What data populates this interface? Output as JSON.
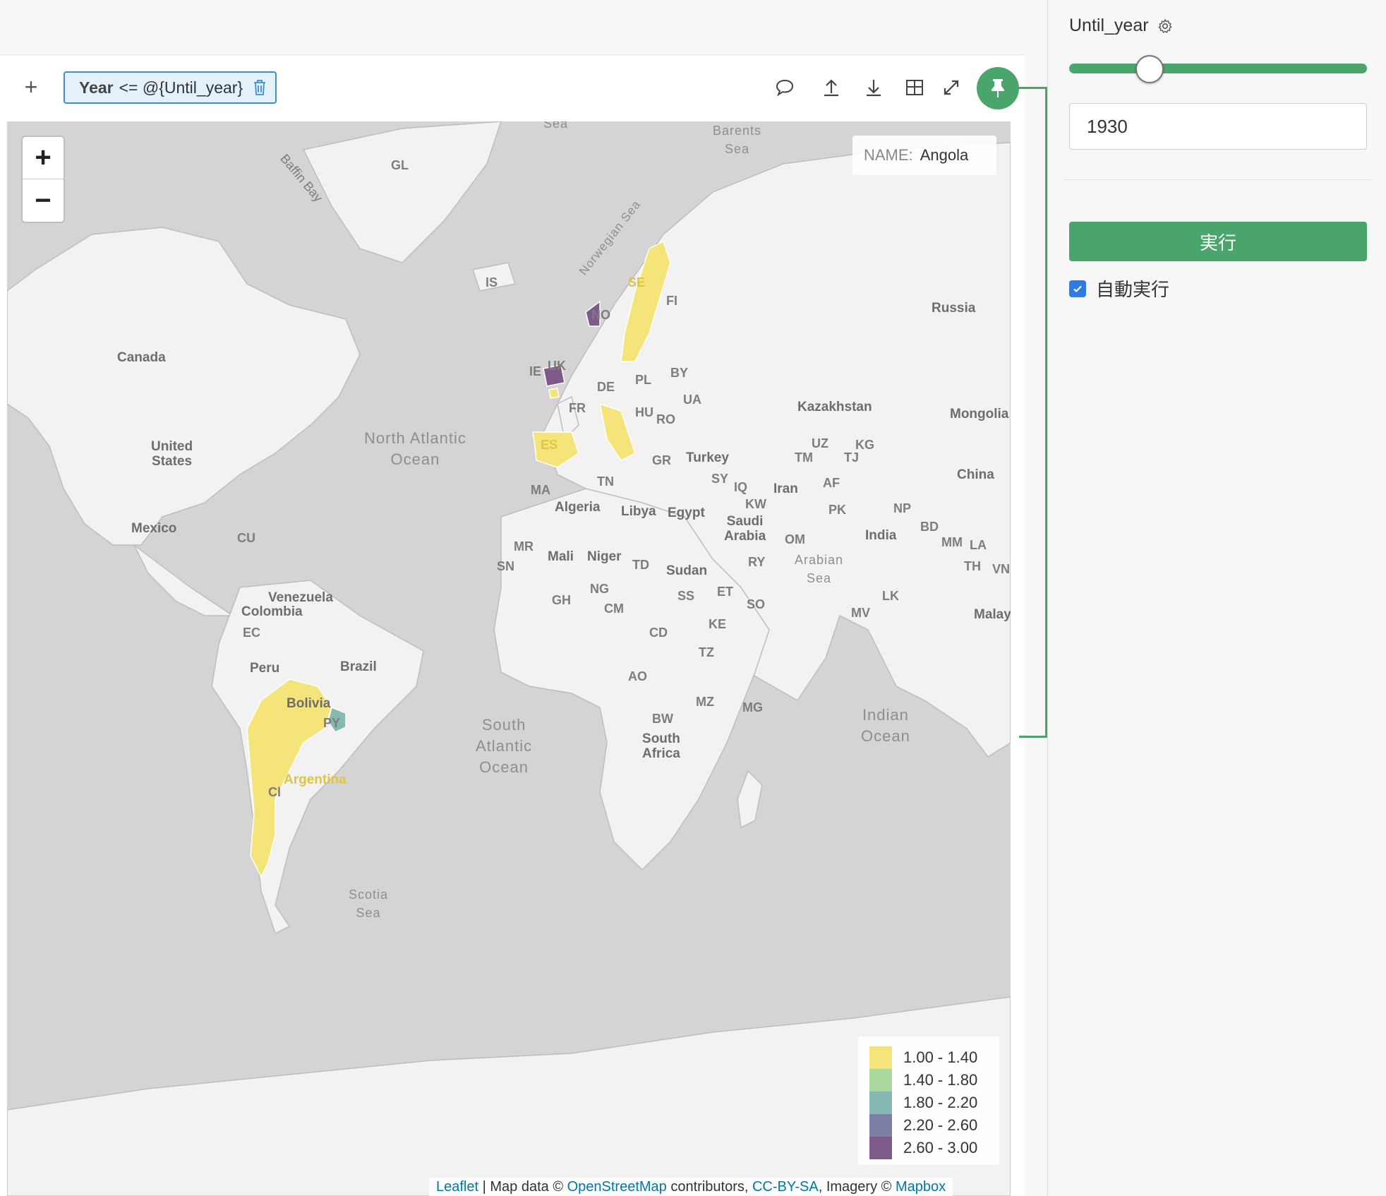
{
  "toolbar": {
    "filter": {
      "field": "Year",
      "expression": "<= @{Until_year}"
    },
    "icons": [
      "plus-icon",
      "comment-icon",
      "upload-icon",
      "download-icon",
      "table-icon",
      "expand-icon",
      "pin-icon"
    ]
  },
  "map": {
    "zoom_in": "+",
    "zoom_out": "−",
    "info": {
      "key": "NAME:",
      "value": "Angola"
    },
    "legend": [
      {
        "label": "1.00 - 1.40",
        "color": "#f5e479"
      },
      {
        "label": "1.40 - 1.80",
        "color": "#a9d89c"
      },
      {
        "label": "1.80 - 2.20",
        "color": "#86b9b1"
      },
      {
        "label": "2.20 - 2.60",
        "color": "#7e7fa6"
      },
      {
        "label": "2.60 - 3.00",
        "color": "#7e5a8a"
      }
    ],
    "attribution": {
      "leaflet": "Leaflet",
      "sep1": " | Map data © ",
      "osm": "OpenStreetMap",
      "sep2": " contributors, ",
      "license": "CC-BY-SA",
      "sep3": ", Imagery © ",
      "mapbox": "Mapbox"
    },
    "labels": {
      "gl": "GL",
      "baffin": "Baffin Bay",
      "barents": "Barents\nSea",
      "norwegian": "Norwegian Sea",
      "is": "IS",
      "no": "NO",
      "se": "SE",
      "fi": "FI",
      "russia": "Russia",
      "canada": "Canada",
      "ie": "IE",
      "uk": "UK",
      "de": "DE",
      "pl": "PL",
      "by": "BY",
      "ua": "UA",
      "fr": "FR",
      "hu": "HU",
      "ro": "RO",
      "kazakhstan": "Kazakhstan",
      "mongolia": "Mongolia",
      "us": "United\nStates",
      "north_atlantic": "North Atlantic\nOcean",
      "es": "ES",
      "gr": "GR",
      "turkey": "Turkey",
      "uz": "UZ",
      "kg": "KG",
      "tm": "TM",
      "tj": "TJ",
      "china": "China",
      "ma": "MA",
      "tn": "TN",
      "sy": "SY",
      "iq": "IQ",
      "iran": "Iran",
      "af": "AF",
      "kw": "KW",
      "pk": "PK",
      "np": "NP",
      "algeria": "Algeria",
      "libya": "Libya",
      "egypt": "Egypt",
      "saudi": "Saudi\nArabia",
      "bd": "BD",
      "mexico": "Mexico",
      "cu": "CU",
      "om": "OM",
      "india": "India",
      "mm": "MM",
      "la": "LA",
      "mr": "MR",
      "mali": "Mali",
      "niger": "Niger",
      "td": "TD",
      "sudan": "Sudan",
      "ry": "RY",
      "arabian": "Arabian\nSea",
      "th": "TH",
      "vn": "VN",
      "sn": "SN",
      "ng": "NG",
      "gh": "GH",
      "ss": "SS",
      "et": "ET",
      "so": "SO",
      "lk": "LK",
      "mv": "MV",
      "malay": "Malay",
      "venezuela": "Venezuela",
      "colombia": "Colombia",
      "ec": "EC",
      "cm": "CM",
      "ke": "KE",
      "cd": "CD",
      "peru": "Peru",
      "brazil": "Brazil",
      "tz": "TZ",
      "ao": "AO",
      "bolivia": "Bolivia",
      "mz": "MZ",
      "mg": "MG",
      "bw": "BW",
      "south_atlantic": "South\nAtlantic\nOcean",
      "south_africa": "South\nAfrica",
      "indian": "Indian\nOcean",
      "py": "PY",
      "argentina": "Argentina",
      "cl": "Cl",
      "scotia": "Scotia\nSea",
      "sea_top": "Sea"
    }
  },
  "panel": {
    "param_name": "Until_year",
    "slider_value": 1930,
    "input_value": "1930",
    "run_label": "実行",
    "auto_run_label": "自動実行",
    "auto_run_checked": true
  }
}
